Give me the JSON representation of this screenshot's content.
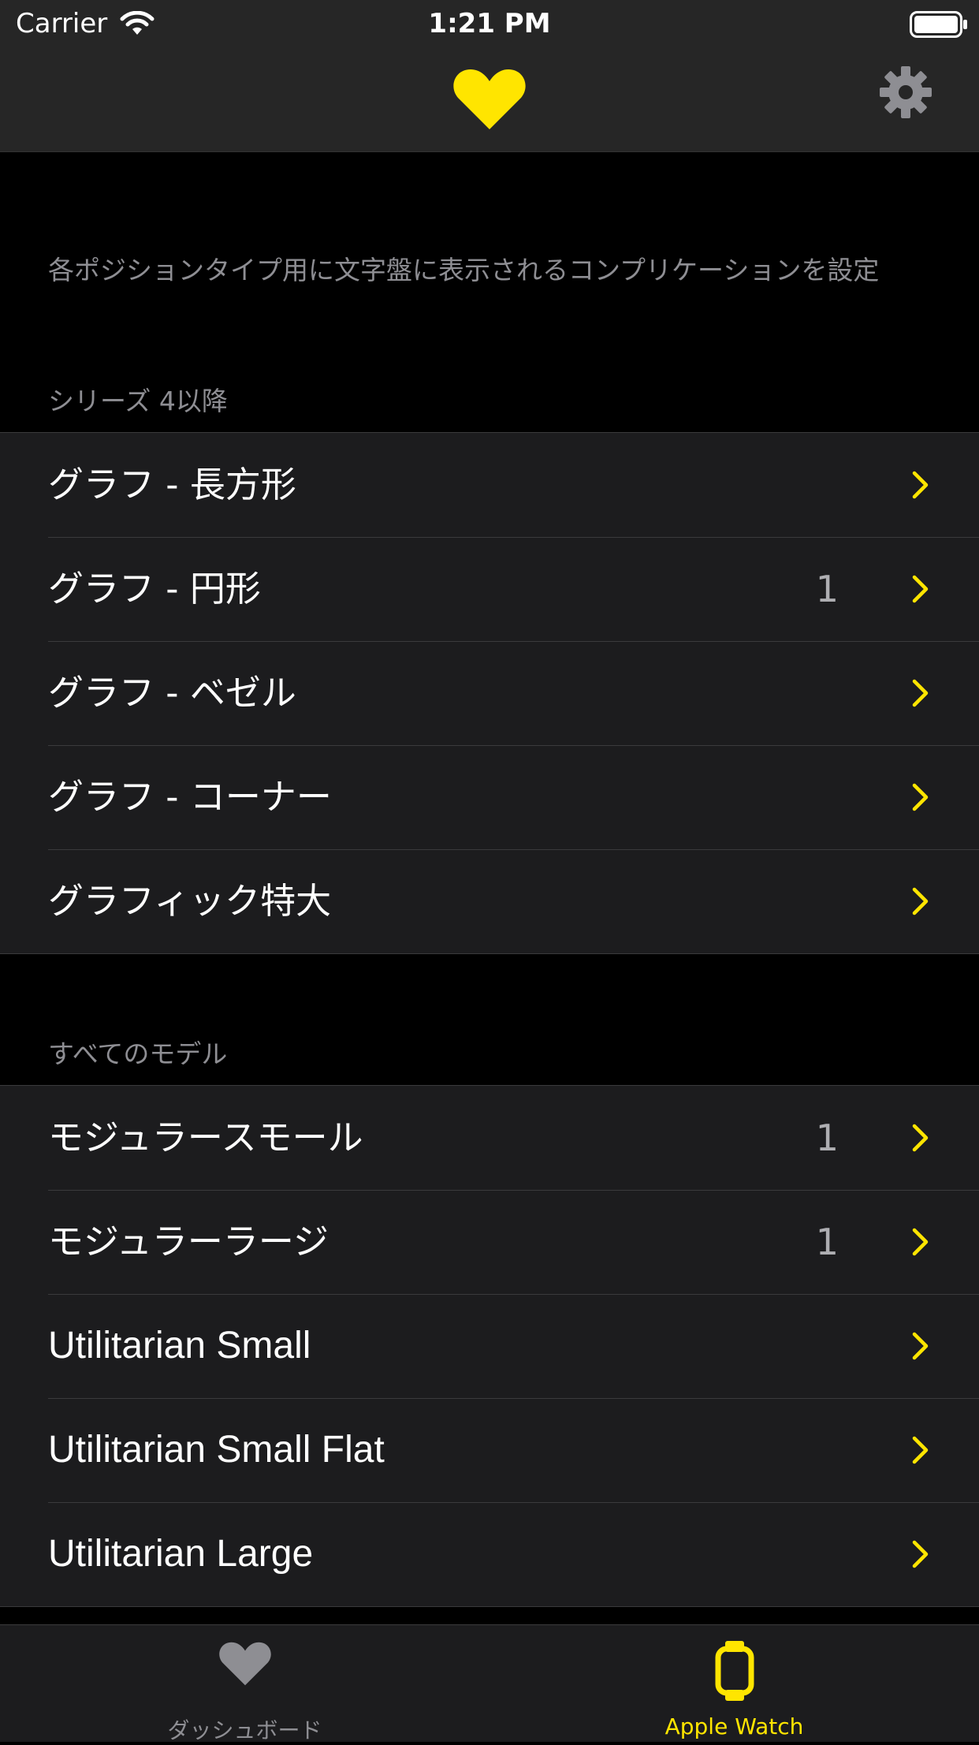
{
  "status_bar": {
    "carrier": "Carrier",
    "time": "1:21 PM"
  },
  "nav": {
    "heart_icon": "heart-icon",
    "settings_icon": "gear-icon"
  },
  "description": "各ポジションタイプ用に文字盤に表示されるコンプリケーションを設定",
  "sections": [
    {
      "header": "シリーズ 4以降",
      "rows": [
        {
          "label": "グラフ - 長方形",
          "value": ""
        },
        {
          "label": "グラフ - 円形",
          "value": "1"
        },
        {
          "label": "グラフ - ベゼル",
          "value": ""
        },
        {
          "label": "グラフ - コーナー",
          "value": ""
        },
        {
          "label": "グラフィック特大",
          "value": ""
        }
      ]
    },
    {
      "header": "すべてのモデル",
      "rows": [
        {
          "label": "モジュラースモール",
          "value": "1"
        },
        {
          "label": "モジュラーラージ",
          "value": "1"
        },
        {
          "label": "Utilitarian Small",
          "value": ""
        },
        {
          "label": "Utilitarian Small Flat",
          "value": ""
        },
        {
          "label": "Utilitarian Large",
          "value": ""
        }
      ]
    }
  ],
  "tab_bar": {
    "tabs": [
      {
        "label": "ダッシュボード",
        "icon": "heart-icon",
        "selected": false
      },
      {
        "label": "Apple Watch",
        "icon": "watch-icon",
        "selected": true
      }
    ]
  },
  "colors": {
    "accent": "#FFE500",
    "inactive": "#8e8e93",
    "background": "#000000",
    "cell": "#1c1c1e"
  }
}
